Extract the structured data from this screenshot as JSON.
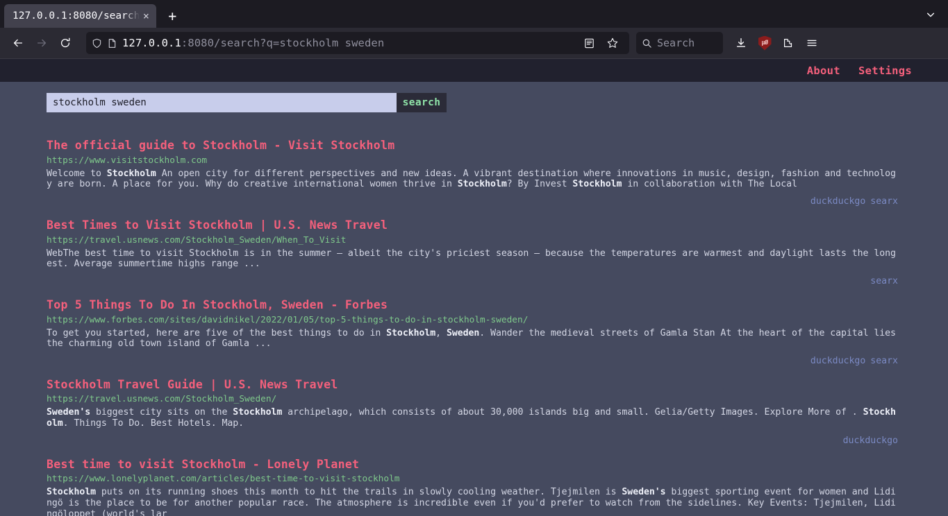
{
  "browser": {
    "tab": {
      "title": "127.0.0.1:8080/search",
      "close_label": "×"
    },
    "new_tab_label": "+",
    "url": {
      "host": "127.0.0.1",
      "rest": ":8080/search?q=stockholm sweden"
    },
    "search_placeholder": "Search",
    "ublock_label": "µØ"
  },
  "site": {
    "nav": [
      {
        "label": "About"
      },
      {
        "label": "Settings"
      }
    ],
    "search": {
      "value": "stockholm sweden",
      "button_label": "search"
    }
  },
  "results": [
    {
      "title": "The official guide to Stockholm - Visit Stockholm",
      "url": "https://www.visitstockholm.com",
      "content_parts": [
        {
          "t": "Welcome to ",
          "b": false
        },
        {
          "t": "Stockholm",
          "b": true
        },
        {
          "t": " An open city for different perspectives and new ideas. A vibrant destination where innovations in music, design, fashion and technology are born. A place for you. Why do creative international women thrive in ",
          "b": false
        },
        {
          "t": "Stockholm",
          "b": true
        },
        {
          "t": "? By Invest ",
          "b": false
        },
        {
          "t": "Stockholm",
          "b": true
        },
        {
          "t": " in collaboration with The Local",
          "b": false
        }
      ],
      "engines": [
        "duckduckgo",
        "searx"
      ]
    },
    {
      "title": "Best Times to Visit Stockholm | U.S. News Travel",
      "url": "https://travel.usnews.com/Stockholm_Sweden/When_To_Visit",
      "content_parts": [
        {
          "t": "WebThe best time to visit Stockholm is in the summer – albeit the city's priciest season – because the temperatures are warmest and daylight lasts the longest. Average summertime highs range ...",
          "b": false
        }
      ],
      "engines": [
        "searx"
      ]
    },
    {
      "title": "Top 5 Things To Do In Stockholm, Sweden - Forbes",
      "url": "https://www.forbes.com/sites/davidnikel/2022/01/05/top-5-things-to-do-in-stockholm-sweden/",
      "content_parts": [
        {
          "t": "To get you started, here are five of the best things to do in ",
          "b": false
        },
        {
          "t": "Stockholm",
          "b": true
        },
        {
          "t": ", ",
          "b": false
        },
        {
          "t": "Sweden",
          "b": true
        },
        {
          "t": ". Wander the medieval streets of Gamla Stan At the heart of the capital lies the charming old town island of Gamla ...",
          "b": false
        }
      ],
      "engines": [
        "duckduckgo",
        "searx"
      ]
    },
    {
      "title": "Stockholm Travel Guide | U.S. News Travel",
      "url": "https://travel.usnews.com/Stockholm_Sweden/",
      "content_parts": [
        {
          "t": "Sweden's",
          "b": true
        },
        {
          "t": " biggest city sits on the ",
          "b": false
        },
        {
          "t": "Stockholm",
          "b": true
        },
        {
          "t": " archipelago, which consists of about 30,000 islands big and small. Gelia/Getty Images. Explore More of . ",
          "b": false
        },
        {
          "t": "Stockholm",
          "b": true
        },
        {
          "t": ". Things To Do. Best Hotels. Map.",
          "b": false
        }
      ],
      "engines": [
        "duckduckgo"
      ]
    },
    {
      "title": "Best time to visit Stockholm - Lonely Planet",
      "url": "https://www.lonelyplanet.com/articles/best-time-to-visit-stockholm",
      "content_parts": [
        {
          "t": "Stockholm",
          "b": true
        },
        {
          "t": " puts on its running shoes this month to hit the trails in slowly cooling weather. Tjejmilen is ",
          "b": false
        },
        {
          "t": "Sweden's",
          "b": true
        },
        {
          "t": " biggest sporting event for women and Lidingö is the place to be for another popular race. The atmosphere is incredible even if you'd prefer to watch from the sidelines. Key Events: Tjejmilen, Lidingöloppet (world's lar",
          "b": false
        }
      ],
      "engines": []
    }
  ]
}
